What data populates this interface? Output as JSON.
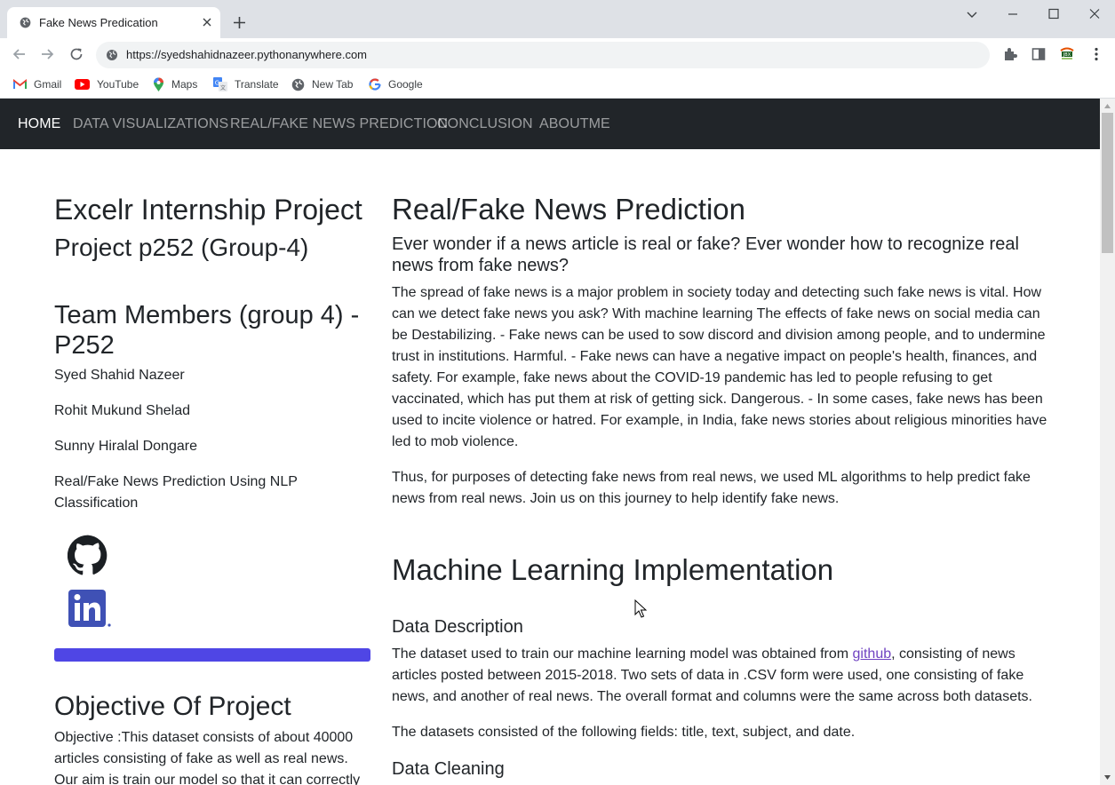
{
  "browser": {
    "tab_title": "Fake News Predication",
    "url": "https://syedshahidnazeer.pythonanywhere.com",
    "bookmarks": [
      {
        "label": "Gmail",
        "icon": "gmail-icon"
      },
      {
        "label": "YouTube",
        "icon": "youtube-icon"
      },
      {
        "label": "Maps",
        "icon": "maps-icon"
      },
      {
        "label": "Translate",
        "icon": "translate-icon"
      },
      {
        "label": "New Tab",
        "icon": "globe-icon"
      },
      {
        "label": "Google",
        "icon": "google-icon"
      }
    ]
  },
  "nav": {
    "home": "HOME",
    "data_viz": "DATA VISUALIZATIONS",
    "prediction": "REAL/FAKE NEWS PREDICTION",
    "conclusion": "CONCLUSION",
    "about": "ABOUTME"
  },
  "sidebar": {
    "title": "Excelr Internship Project",
    "project": "Project p252 (Group-4)",
    "team_heading": "Team Members (group 4) - P252",
    "members": [
      "Syed Shahid Nazeer",
      "Rohit Mukund Shelad",
      "Sunny Hiralal Dongare"
    ],
    "project_desc": "Real/Fake News Prediction Using NLP Classification",
    "icons": [
      "github-icon",
      "linkedin-icon"
    ],
    "accent_color": "#4f46e5",
    "objective_heading": "Objective Of Project",
    "objective_text": "Objective :This dataset consists of about 40000 articles consisting of fake as well as real news. Our aim is train our model so that it can correctly"
  },
  "main": {
    "title": "Real/Fake News Prediction",
    "subtitle": "Ever wonder if a news article is real or fake? Ever wonder how to recognize real news from fake news?",
    "para1": "The spread of fake news is a major problem in society today and detecting such fake news is vital. How can we detect fake news you ask? With machine learning The effects of fake news on social media can be Destabilizing. - Fake news can be used to sow discord and division among people, and to undermine trust in institutions. Harmful. - Fake news can have a negative impact on people's health, finances, and safety. For example, fake news about the COVID-19 pandemic has led to people refusing to get vaccinated, which has put them at risk of getting sick. Dangerous. - In some cases, fake news has been used to incite violence or hatred. For example, in India, fake news stories about religious minorities have led to mob violence.",
    "para2": "Thus, for purposes of detecting fake news from real news, we used ML algorithms to help predict fake news from real news. Join us on this journey to help identify fake news.",
    "ml_heading": "Machine Learning Implementation",
    "data_desc_heading": "Data Description",
    "data_desc_before": "The dataset used to train our machine learning model was obtained from ",
    "data_desc_link": "github",
    "data_desc_after": ", consisting of news articles posted between 2015-2018. Two sets of data in .CSV form were used, one consisting of fake news, and another of real news. The overall format and columns were the same across both datasets.",
    "fields_text": "The datasets consisted of the following fields: title, text, subject, and date.",
    "cleaning_heading": "Data Cleaning"
  }
}
